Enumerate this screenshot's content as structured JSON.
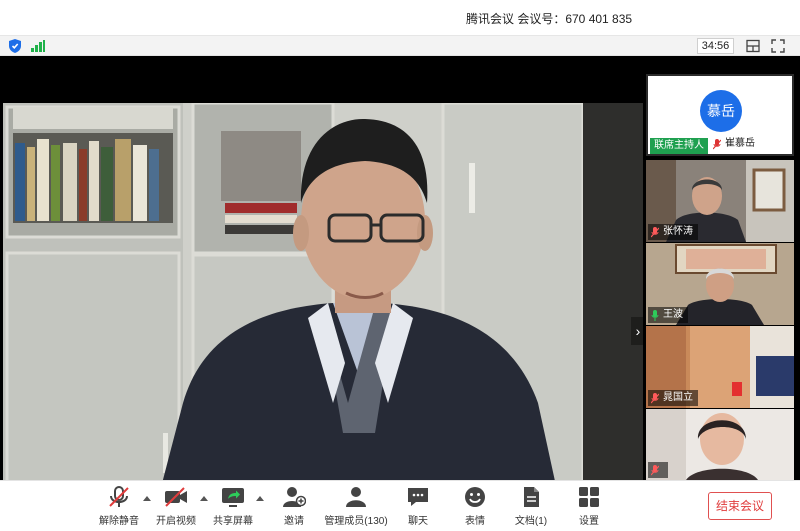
{
  "window": {
    "title": "腾讯会议 会议号：670 401 835"
  },
  "status": {
    "timer": "34:56",
    "shield_icon": "shield-icon",
    "signal_icon": "signal-icon"
  },
  "participants": [
    {
      "name": "崔慕岳",
      "avatar_text": "慕岳",
      "badge": "联席主持人",
      "mic": "muted"
    },
    {
      "name": "张怀涛",
      "mic": "muted"
    },
    {
      "name": "王波",
      "mic": "active"
    },
    {
      "name": "晁国立",
      "mic": "muted"
    },
    {
      "name": "",
      "mic": "muted"
    }
  ],
  "toolbar": {
    "unmute": "解除静音",
    "start_video": "开启视频",
    "share_screen": "共享屏幕",
    "invite": "邀请",
    "manage_members": "管理成员(130)",
    "chat": "聊天",
    "reactions": "表情",
    "documents": "文档(1)",
    "settings": "设置",
    "end_meeting": "结束会议"
  },
  "colors": {
    "accent": "#1d6ee8",
    "active_green": "#1fa050",
    "danger": "#e03c3c"
  }
}
